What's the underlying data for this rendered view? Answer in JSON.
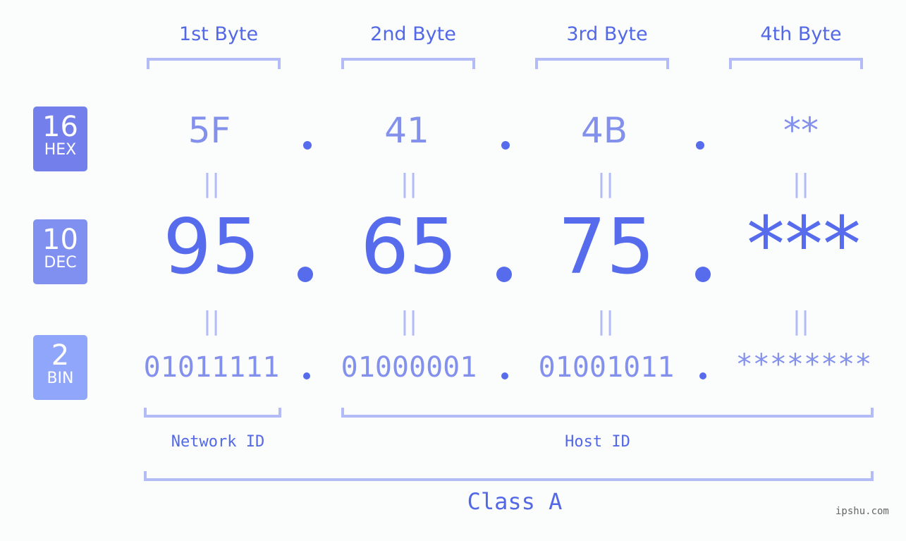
{
  "bytes": {
    "headers": [
      "1st Byte",
      "2nd Byte",
      "3rd Byte",
      "4th Byte"
    ]
  },
  "badges": {
    "hex": {
      "number": "16",
      "label": "HEX",
      "color": "#7380eb"
    },
    "dec": {
      "number": "10",
      "label": "DEC",
      "color": "#8090f0"
    },
    "bin": {
      "number": "2",
      "label": "BIN",
      "color": "#8fa6fa"
    }
  },
  "hex_values": [
    "5F",
    "41",
    "4B",
    "**"
  ],
  "dec_values": [
    "95",
    "65",
    "75",
    "***"
  ],
  "bin_values": [
    "01011111",
    "01000001",
    "01001011",
    "********"
  ],
  "equals_symbol": "||",
  "separator": ".",
  "labels": {
    "network_id": "Network ID",
    "host_id": "Host ID",
    "class": "Class A"
  },
  "watermark": "ipshu.com",
  "colors": {
    "primary": "#566ced",
    "light": "#8391ed",
    "bracket": "#b3bcf6"
  }
}
